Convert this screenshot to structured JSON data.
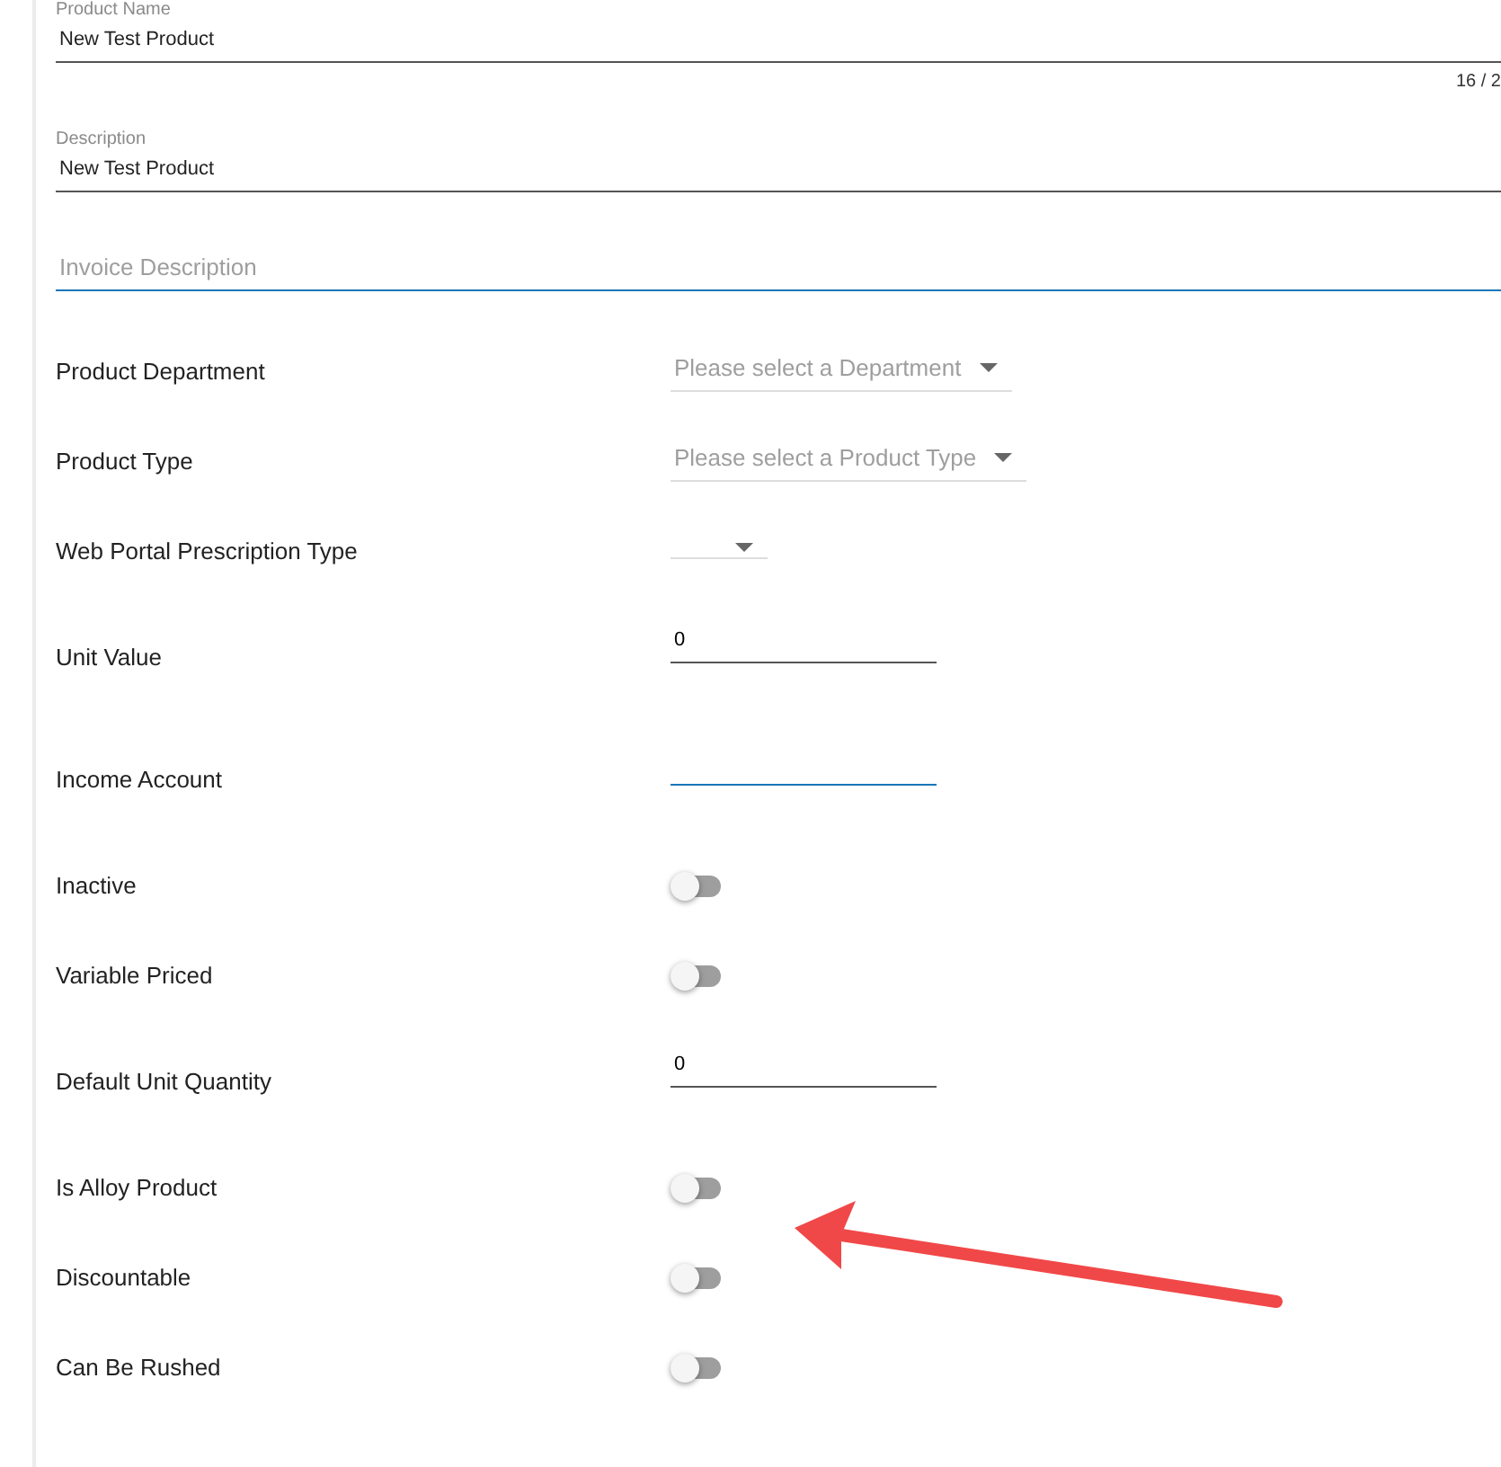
{
  "top_fields": [
    {
      "label": "Product Name",
      "value": "New Test Product",
      "counter": "16 / 2",
      "focused": false
    },
    {
      "label": "Description",
      "value": "New Test Product",
      "focused": false
    },
    {
      "placeholder": "Invoice Description",
      "focused": true
    }
  ],
  "rows": [
    {
      "kind": "select",
      "label": "Product Department",
      "placeholder": "Please select a Department"
    },
    {
      "kind": "select",
      "label": "Product Type",
      "placeholder": "Please select a Product Type"
    },
    {
      "kind": "select",
      "label": "Web Portal Prescription Type"
    },
    {
      "kind": "text",
      "label": "Unit Value",
      "value": "0",
      "focused": false
    },
    {
      "kind": "text",
      "label": "Income Account",
      "focused": true
    },
    {
      "kind": "toggle",
      "label": "Inactive",
      "on": false
    },
    {
      "kind": "toggle",
      "label": "Variable Priced",
      "on": false
    },
    {
      "kind": "text",
      "label": "Default Unit Quantity",
      "value": "0",
      "focused": false
    },
    {
      "kind": "toggle",
      "label": "Is Alloy Product",
      "on": false
    },
    {
      "kind": "toggle",
      "label": "Discountable",
      "on": false
    },
    {
      "kind": "toggle",
      "label": "Can Be Rushed",
      "on": false
    }
  ]
}
